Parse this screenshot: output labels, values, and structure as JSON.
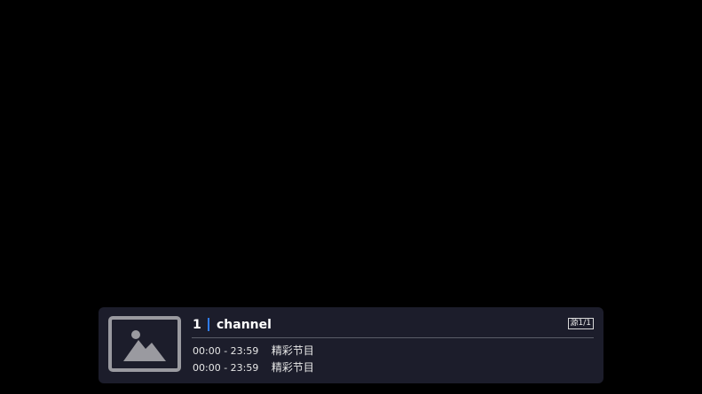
{
  "channel": {
    "number": "1",
    "name": "channel",
    "source_badge": "源1/1",
    "logo_icon": "image-placeholder-icon"
  },
  "epg": [
    {
      "time": "00:00 - 23:59",
      "title": "精彩节目"
    },
    {
      "time": "00:00 - 23:59",
      "title": "精彩节目"
    }
  ],
  "colors": {
    "background": "#000000",
    "panel": "#1c1d2b",
    "accent": "#2f7cf6",
    "text": "#ffffff",
    "placeholder": "#9a9aa0"
  }
}
